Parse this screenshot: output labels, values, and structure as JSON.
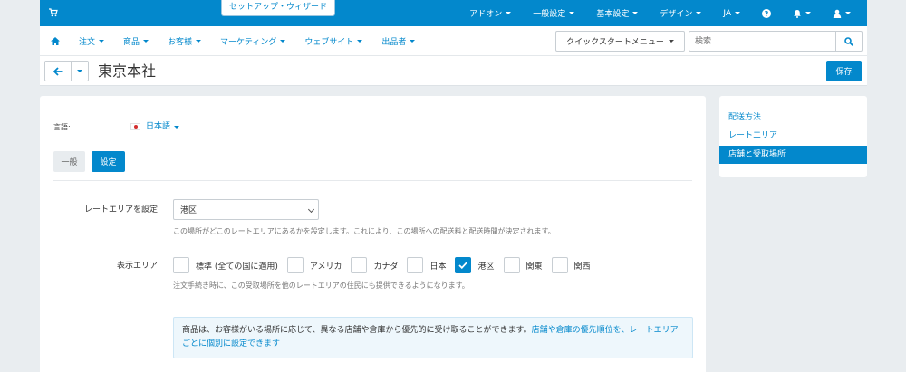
{
  "topbar": {
    "wizard": "セットアップ・ウィザード",
    "menu": [
      {
        "label": "アドオン"
      },
      {
        "label": "一般設定"
      },
      {
        "label": "基本設定"
      },
      {
        "label": "デザイン"
      },
      {
        "label": "JA"
      }
    ]
  },
  "nav": {
    "items": [
      {
        "label": "注文"
      },
      {
        "label": "商品"
      },
      {
        "label": "お客様"
      },
      {
        "label": "マーケティング"
      },
      {
        "label": "ウェブサイト"
      },
      {
        "label": "出品者"
      }
    ],
    "quickstart": "クイックスタートメニュー",
    "search_placeholder": "検索"
  },
  "header": {
    "title": "東京本社",
    "save_label": "保存"
  },
  "form": {
    "language_label": "言語:",
    "language_value": "日本語",
    "tab_general": "一般",
    "tab_settings": "設定",
    "rate_area_label": "レートエリアを設定:",
    "rate_area_value": "港区",
    "rate_area_help": "この場所がどこのレートエリアにあるかを設定します。これにより、この場所への配送料と配送時間が決定されます。",
    "display_area_label": "表示エリア:",
    "areas": [
      {
        "label": "標準 (全ての国に適用)",
        "checked": false
      },
      {
        "label": "アメリカ",
        "checked": false
      },
      {
        "label": "カナダ",
        "checked": false
      },
      {
        "label": "日本",
        "checked": false
      },
      {
        "label": "港区",
        "checked": true
      },
      {
        "label": "関東",
        "checked": false
      },
      {
        "label": "関西",
        "checked": false
      }
    ],
    "display_area_help": "注文手続き時に、この受取場所を他のレートエリアの住民にも提供できるようになります。",
    "info_text": "商品は、お客様がいる場所に応じて、異なる店舗や倉庫から優先的に受け取ることができます。",
    "info_link": "店舗や倉庫の優先順位を、レートエリアごとに個別に設定できます"
  },
  "sidebar": {
    "items": [
      {
        "label": "配送方法",
        "active": false
      },
      {
        "label": "レートエリア",
        "active": false
      },
      {
        "label": "店舗と受取場所",
        "active": true
      }
    ]
  },
  "colors": {
    "primary": "#0388cc",
    "background": "#e9edf0"
  }
}
